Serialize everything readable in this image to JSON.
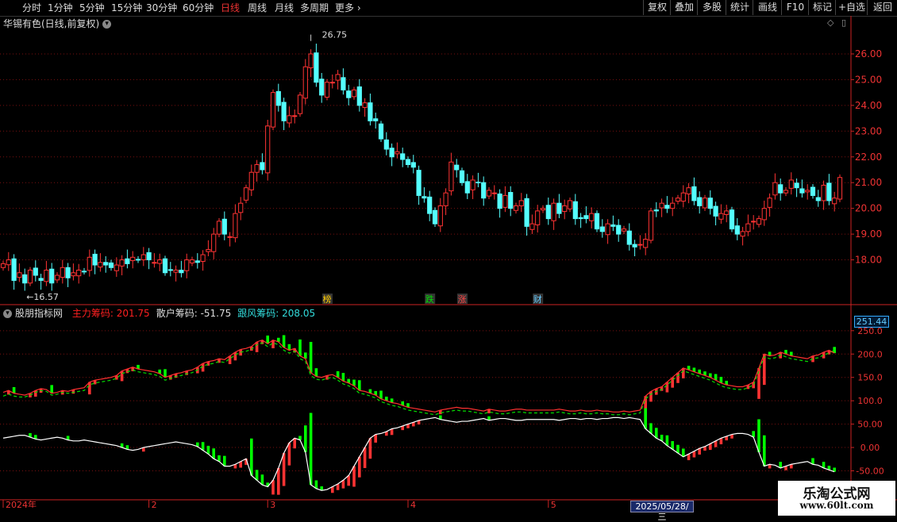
{
  "toolbar": {
    "periods": [
      "分时",
      "1分钟",
      "5分钟",
      "15分钟",
      "30分钟",
      "60分钟",
      "日线",
      "周线",
      "月线",
      "多周期",
      "更多"
    ],
    "active_period": "日线",
    "more_icon": "chevron-right-icon",
    "tools": [
      "复权",
      "叠加",
      "多股",
      "统计",
      "画线",
      "F10",
      "标记",
      "+自选",
      "返回"
    ]
  },
  "chart_title": "华锡有色(日线,前复权)",
  "window_icons": [
    "diamond-icon",
    "restore-icon"
  ],
  "indicator": {
    "name": "股朋指标网",
    "items": [
      {
        "label": "主力筹码:",
        "value": "201.75",
        "color": "#ff2020"
      },
      {
        "label": "散户筹码:",
        "value": "-51.75",
        "color": "#dddddd"
      },
      {
        "label": "跟风筹码:",
        "value": "208.05",
        "color": "#33dddd"
      }
    ],
    "cursor_value": "251.44"
  },
  "events": [
    {
      "label": "榜",
      "idx": 60,
      "color": "#ffcc00",
      "bg": "#333"
    },
    {
      "label": "跌",
      "idx": 79,
      "color": "#00dd00",
      "bg": "#333"
    },
    {
      "label": "涨",
      "idx": 85,
      "color": "#ff4444",
      "bg": "#333"
    },
    {
      "label": "财",
      "idx": 99,
      "color": "#66ccff",
      "bg": "#333"
    }
  ],
  "date_labels": [
    {
      "label": "2024年",
      "idx": 0
    },
    {
      "label": "2",
      "idx": 27
    },
    {
      "label": "3",
      "idx": 49
    },
    {
      "label": "4",
      "idx": 75
    },
    {
      "label": "5",
      "idx": 101
    }
  ],
  "cursor_date": "2025/05/28/三",
  "watermark": {
    "line1": "乐淘公式网",
    "line2": "www.60lt.com"
  },
  "colors": {
    "up": "#ff3333",
    "down": "#54ffff",
    "main": "#ff2020",
    "retail": "#ffffff",
    "follow": "#00ff00",
    "grid": "#7a1010",
    "axis": "#cc2222"
  },
  "chart_data": [
    {
      "type": "candlestick",
      "title": "华锡有色(日线,前复权)",
      "ylim": [
        17.0,
        26.8
      ],
      "yticks": [
        18.0,
        19.0,
        20.0,
        21.0,
        22.0,
        23.0,
        24.0,
        25.0,
        26.0
      ],
      "marked_high": "26.75",
      "marked_low": "16.57",
      "closes": [
        17.85,
        18.0,
        17.2,
        17.5,
        17.1,
        17.6,
        17.4,
        17.2,
        17.6,
        17.1,
        17.4,
        17.7,
        17.3,
        17.5,
        17.6,
        17.55,
        18.1,
        17.8,
        17.9,
        17.8,
        17.7,
        17.8,
        18.0,
        17.85,
        18.1,
        18.0,
        18.2,
        18.0,
        17.9,
        18.0,
        17.5,
        17.6,
        17.6,
        17.5,
        18.0,
        18.0,
        17.9,
        18.2,
        18.4,
        19.0,
        19.5,
        19.0,
        18.9,
        19.8,
        20.2,
        20.8,
        21.4,
        21.7,
        21.5,
        23.2,
        24.5,
        24.0,
        23.4,
        23.6,
        23.6,
        24.4,
        25.5,
        26.0,
        24.9,
        24.4,
        24.9,
        24.9,
        25.2,
        24.6,
        24.3,
        24.6,
        24.0,
        24.1,
        23.4,
        23.4,
        22.7,
        22.3,
        22.0,
        22.2,
        21.9,
        21.7,
        21.6,
        20.5,
        20.4,
        19.8,
        19.4,
        20.1,
        20.6,
        21.8,
        21.5,
        21.0,
        20.6,
        21.1,
        21.0,
        20.4,
        20.7,
        20.6,
        20.0,
        20.5,
        20.0,
        20.1,
        20.3,
        19.3,
        19.4,
        19.9,
        20.0,
        19.6,
        20.2,
        19.8,
        20.1,
        20.3,
        19.6,
        19.6,
        19.6,
        19.8,
        19.2,
        19.1,
        19.4,
        19.3,
        19.0,
        19.2,
        18.6,
        18.5,
        18.6,
        18.8,
        19.9,
        19.9,
        20.2,
        20.0,
        20.2,
        20.4,
        20.6,
        20.8,
        20.3,
        20.1,
        20.4,
        20.0,
        19.7,
        19.8,
        19.9,
        19.2,
        19.0,
        19.1,
        19.4,
        19.5,
        19.6,
        20.0,
        20.4,
        21.0,
        20.6,
        20.7,
        21.1,
        20.8,
        20.6,
        20.7,
        20.5,
        20.3,
        20.9,
        20.3,
        20.4,
        21.2
      ],
      "series": [
        {
          "name": "主力筹码",
          "value": "201.75"
        }
      ]
    },
    {
      "type": "line",
      "title": "股朋指标网",
      "ylim": [
        -95,
        265
      ],
      "yticks": [
        -50,
        0,
        50,
        100,
        150,
        200,
        250
      ],
      "yticklabels": [
        "-50.00",
        "0.00",
        "50.00",
        "100.0",
        "150.0",
        "200.0",
        "250.0"
      ],
      "series": [
        {
          "name": "主力筹码",
          "values": [
            118,
            122,
            116,
            114,
            112,
            116,
            122,
            126,
            124,
            116,
            118,
            122,
            120,
            124,
            126,
            128,
            140,
            144,
            146,
            148,
            150,
            154,
            164,
            168,
            172,
            168,
            166,
            164,
            162,
            158,
            150,
            154,
            158,
            160,
            164,
            166,
            172,
            180,
            184,
            186,
            190,
            188,
            196,
            204,
            210,
            212,
            216,
            226,
            230,
            222,
            230,
            226,
            214,
            208,
            212,
            196,
            190,
            160,
            152,
            150,
            154,
            156,
            150,
            142,
            138,
            132,
            122,
            120,
            116,
            112,
            104,
            100,
            96,
            94,
            90,
            86,
            84,
            82,
            80,
            78,
            76,
            80,
            82,
            84,
            86,
            84,
            84,
            82,
            80,
            78,
            82,
            80,
            78,
            78,
            80,
            82,
            82,
            80,
            80,
            80,
            80,
            80,
            80,
            82,
            80,
            78,
            78,
            80,
            78,
            78,
            80,
            78,
            78,
            76,
            76,
            78,
            76,
            78,
            80,
            110,
            120,
            126,
            130,
            140,
            150,
            160,
            170,
            166,
            162,
            158,
            154,
            150,
            144,
            138,
            134,
            132,
            130,
            130,
            134,
            140,
            170,
            200,
            196,
            198,
            204,
            200,
            196,
            194,
            192,
            190,
            196,
            198,
            204,
            208,
            202
          ]
        },
        {
          "name": "散户筹码",
          "values": [
            20,
            22,
            24,
            26,
            26,
            22,
            18,
            16,
            18,
            20,
            22,
            20,
            16,
            14,
            14,
            16,
            14,
            12,
            10,
            8,
            6,
            4,
            0,
            -4,
            -6,
            -4,
            0,
            2,
            4,
            6,
            8,
            10,
            12,
            10,
            8,
            6,
            2,
            -6,
            -14,
            -24,
            -30,
            -40,
            -40,
            -36,
            -30,
            -24,
            -60,
            -70,
            -80,
            -84,
            -70,
            -44,
            -12,
            10,
            20,
            16,
            -10,
            -80,
            -88,
            -92,
            -90,
            -84,
            -78,
            -70,
            -60,
            -40,
            -20,
            0,
            20,
            28,
            30,
            34,
            40,
            42,
            46,
            50,
            54,
            58,
            60,
            62,
            64,
            60,
            58,
            56,
            54,
            56,
            56,
            58,
            60,
            62,
            58,
            60,
            62,
            62,
            60,
            58,
            58,
            60,
            60,
            60,
            60,
            60,
            60,
            58,
            60,
            62,
            62,
            60,
            62,
            62,
            60,
            62,
            62,
            64,
            64,
            62,
            64,
            62,
            60,
            40,
            30,
            20,
            14,
            4,
            -4,
            -12,
            -20,
            -14,
            -8,
            -2,
            2,
            8,
            14,
            20,
            24,
            28,
            30,
            30,
            28,
            22,
            -10,
            -40,
            -36,
            -38,
            -44,
            -40,
            -36,
            -34,
            -32,
            -30,
            -36,
            -38,
            -44,
            -48,
            -52
          ]
        },
        {
          "name": "跟风筹码",
          "values": [
            110,
            114,
            110,
            108,
            108,
            112,
            118,
            122,
            120,
            112,
            114,
            118,
            116,
            118,
            120,
            122,
            134,
            138,
            140,
            142,
            144,
            148,
            158,
            162,
            166,
            162,
            160,
            158,
            156,
            152,
            144,
            148,
            152,
            154,
            158,
            160,
            166,
            174,
            178,
            180,
            184,
            182,
            190,
            198,
            204,
            206,
            210,
            220,
            224,
            216,
            224,
            220,
            208,
            202,
            206,
            190,
            184,
            154,
            146,
            144,
            148,
            150,
            144,
            136,
            132,
            126,
            116,
            114,
            110,
            106,
            98,
            94,
            90,
            88,
            84,
            80,
            78,
            76,
            74,
            72,
            70,
            74,
            76,
            78,
            80,
            78,
            78,
            76,
            74,
            72,
            76,
            74,
            72,
            72,
            74,
            76,
            76,
            74,
            74,
            74,
            74,
            74,
            74,
            76,
            74,
            72,
            72,
            74,
            72,
            72,
            74,
            72,
            72,
            70,
            70,
            72,
            70,
            72,
            74,
            104,
            114,
            120,
            124,
            134,
            144,
            154,
            164,
            160,
            156,
            152,
            148,
            144,
            138,
            132,
            128,
            126,
            124,
            124,
            128,
            134,
            164,
            194,
            190,
            192,
            198,
            194,
            190,
            188,
            186,
            184,
            190,
            192,
            198,
            202,
            208
          ]
        }
      ]
    }
  ]
}
